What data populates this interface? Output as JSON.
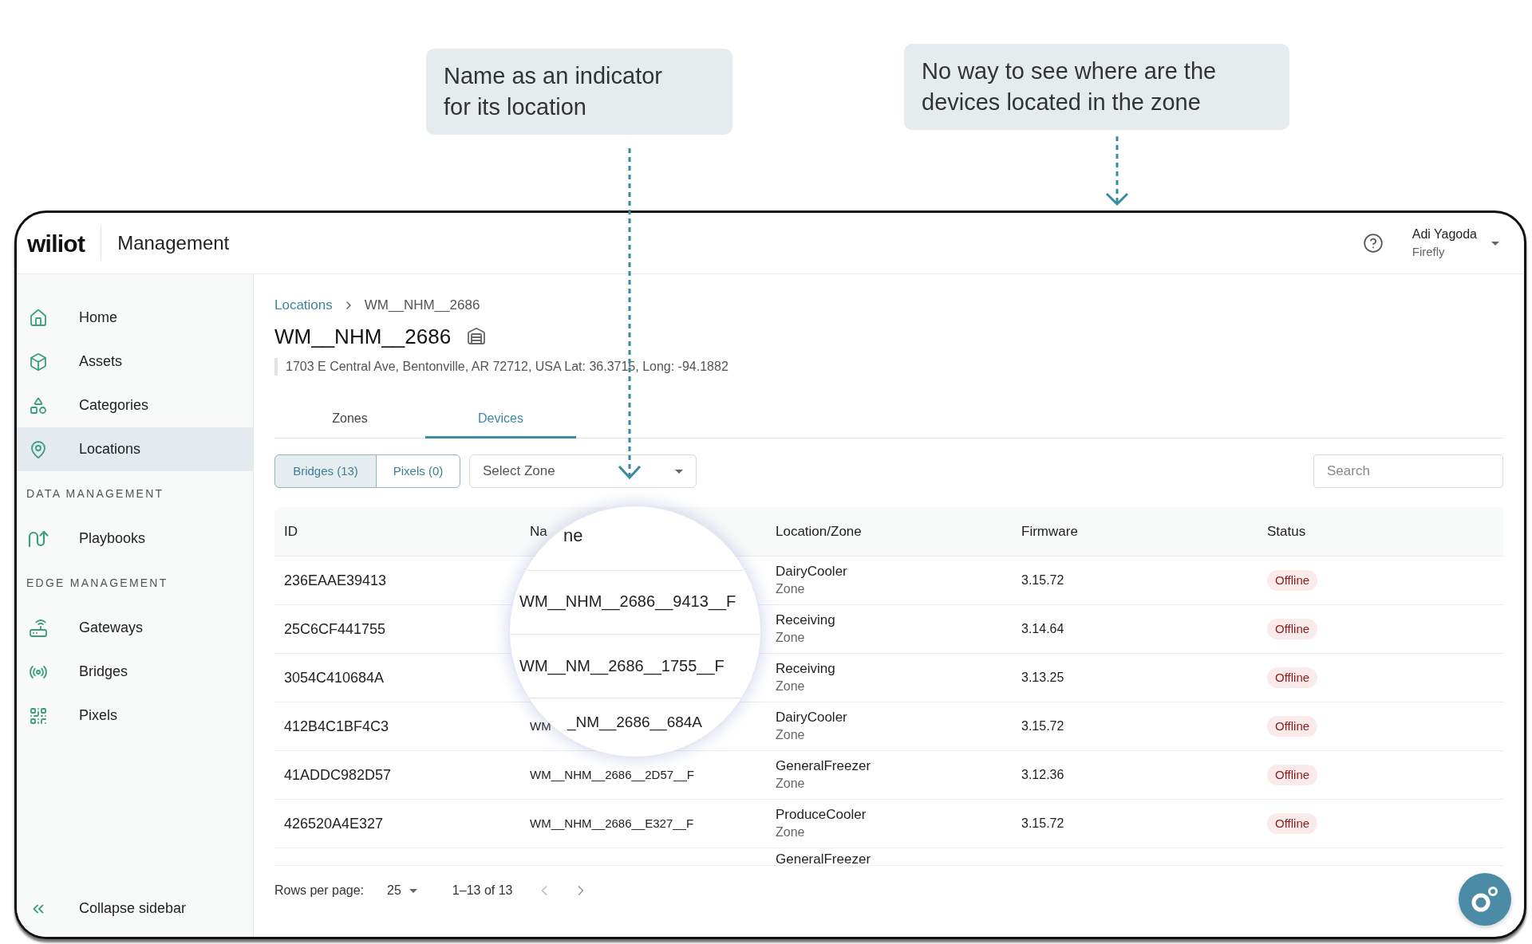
{
  "annotations": [
    {
      "text": "Name as an indicator for its location"
    },
    {
      "text": "No way to see where are the devices located in the zone"
    }
  ],
  "header": {
    "logo": "wiliot",
    "title": "Management",
    "user_name": "Adi Yagoda",
    "user_org": "Firefly"
  },
  "sidebar": {
    "items": [
      {
        "kind": "item",
        "label": "Home",
        "selected": false
      },
      {
        "kind": "item",
        "label": "Assets",
        "selected": false
      },
      {
        "kind": "item",
        "label": "Categories",
        "selected": false
      },
      {
        "kind": "item",
        "label": "Locations",
        "selected": true
      },
      {
        "kind": "section",
        "label": "DATA MANAGEMENT"
      },
      {
        "kind": "item",
        "label": "Playbooks",
        "selected": false
      },
      {
        "kind": "section",
        "label": "EDGE MANAGEMENT"
      },
      {
        "kind": "item",
        "label": "Gateways",
        "selected": false
      },
      {
        "kind": "item",
        "label": "Bridges",
        "selected": false
      },
      {
        "kind": "item",
        "label": "Pixels",
        "selected": false
      }
    ],
    "collapse": "Collapse sidebar"
  },
  "page": {
    "breadcrumb": {
      "parent": "Locations",
      "current": "WM__NHM__2686"
    },
    "title": "WM__NHM__2686",
    "address": "1703 E Central Ave, Bentonville, AR 72712, USA Lat: 36.3715, Long: -94.1882",
    "tabs": [
      {
        "label": "Zones",
        "selected": false
      },
      {
        "label": "Devices",
        "selected": true
      }
    ],
    "device_types": [
      {
        "label": "Bridges (13)",
        "selected": true
      },
      {
        "label": "Pixels (0)",
        "selected": false
      }
    ],
    "zone_select": {
      "placeholder": "Select Zone"
    },
    "search": {
      "placeholder": "Search"
    }
  },
  "table": {
    "columns": [
      "ID",
      "Na",
      "Location/Zone",
      "Firmware",
      "Status"
    ],
    "rows": [
      {
        "kind": "full",
        "id": "236EAAE39413",
        "location": "DairyCooler",
        "location_type": "Zone",
        "firmware": "3.15.72",
        "status": "Offline"
      },
      {
        "kind": "full",
        "id": "25C6CF441755",
        "location": "Receiving",
        "location_type": "Zone",
        "firmware": "3.14.64",
        "status": "Offline"
      },
      {
        "kind": "full",
        "id": "3054C410684A",
        "location": "Receiving",
        "location_type": "Zone",
        "firmware": "3.13.25",
        "status": "Offline"
      },
      {
        "kind": "full",
        "id": "412B4C1BF4C3",
        "name": "WM",
        "location": "DairyCooler",
        "location_type": "Zone",
        "firmware": "3.15.72",
        "status": "Offline"
      },
      {
        "kind": "full",
        "id": "41ADDC982D57",
        "name": "WM__NHM__2686__2D57__F",
        "location": "GeneralFreezer",
        "location_type": "Zone",
        "firmware": "3.12.36",
        "status": "Offline"
      },
      {
        "kind": "full",
        "id": "426520A4E327",
        "name": "WM__NHM__2686__E327__F",
        "location": "ProduceCooler",
        "location_type": "Zone",
        "firmware": "3.15.72",
        "status": "Offline"
      },
      {
        "kind": "cut",
        "location": "GeneralFreezer"
      }
    ]
  },
  "magnifier": {
    "heading": "ne",
    "lines": [
      "WM__NHM__2686__9413__F",
      "WM__NM__2686__1755__F",
      "_NM__2686__684A"
    ]
  },
  "pagination": {
    "rows_per_page_label": "Rows per page:",
    "rows_per_page": "25",
    "range": "1–13 of 13"
  }
}
